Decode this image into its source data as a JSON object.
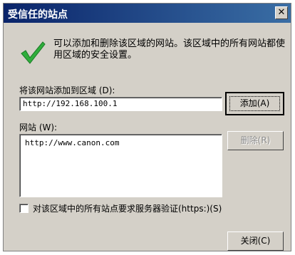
{
  "window": {
    "title": "受信任的站点",
    "close_glyph": "✕"
  },
  "info": {
    "icon": "checkmark-icon",
    "line1": "可以添加和删除该区域的网站。该区域中的所有网站都使",
    "line2": "用区域的安全设置。"
  },
  "add": {
    "label": "将该网站添加到区域 (D):",
    "value": "http://192.168.100.1",
    "button": "添加(A)"
  },
  "sites": {
    "label": "网站 (W):",
    "items": [
      "http://www.canon.com"
    ],
    "remove_button": "删除(R)"
  },
  "verify": {
    "label": "对该区域中的所有站点要求服务器验证(https:)(S)",
    "checked": false
  },
  "close_button": "关闭(C)",
  "colors": {
    "titlebar_start": "#0a246a",
    "titlebar_end": "#3a6ea5",
    "dialog_bg": "#d4d0c8",
    "check_green": "#2fae3c"
  }
}
